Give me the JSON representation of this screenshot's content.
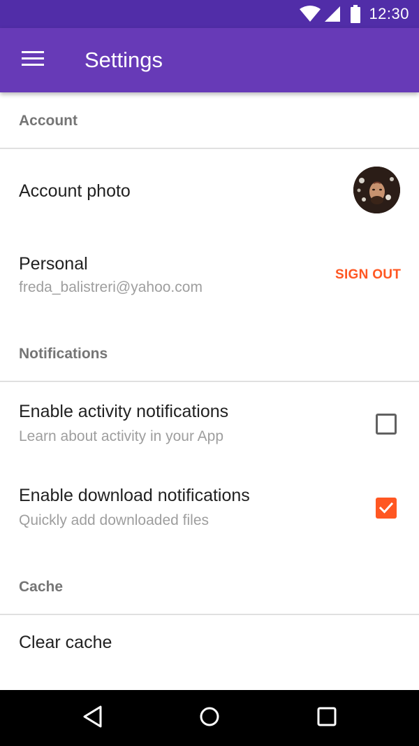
{
  "status_bar": {
    "time": "12:30",
    "icons": [
      "wifi-icon",
      "cell-signal-icon",
      "battery-icon"
    ]
  },
  "app_bar": {
    "menu_icon": "menu-icon",
    "title": "Settings"
  },
  "sections": {
    "account": {
      "header": "Account",
      "account_photo": {
        "title": "Account photo"
      },
      "personal": {
        "title": "Personal",
        "email": "freda_balistreri@yahoo.com",
        "action_label": "SIGN OUT"
      }
    },
    "notifications": {
      "header": "Notifications",
      "activity": {
        "title": "Enable activity notifications",
        "subtitle": "Learn about activity in your App",
        "checked": false
      },
      "download": {
        "title": "Enable download notifications",
        "subtitle": "Quickly add downloaded files",
        "checked": true
      }
    },
    "cache": {
      "header": "Cache",
      "clear": {
        "title": "Clear cache"
      }
    }
  },
  "nav_bar": {
    "icons": [
      "back-icon",
      "home-icon",
      "recents-icon"
    ]
  },
  "colors": {
    "status_bar": "#512da8",
    "app_bar": "#673ab7",
    "accent": "#ff5722",
    "nav_bar": "#000000"
  }
}
